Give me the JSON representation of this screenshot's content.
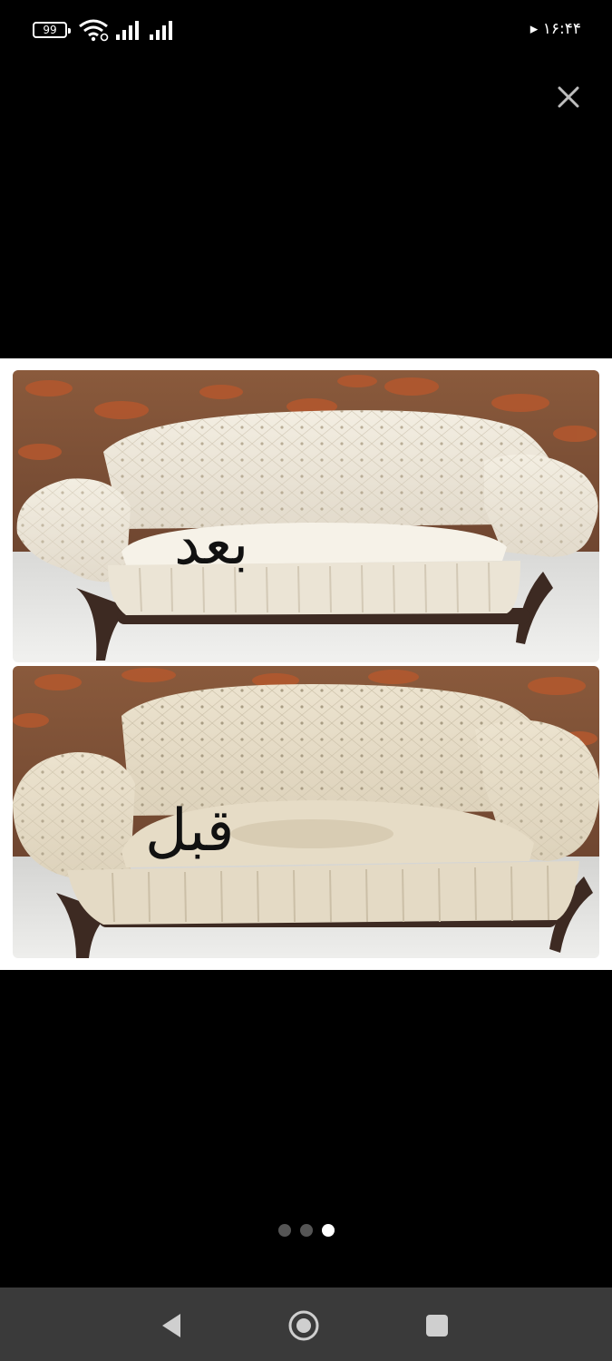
{
  "status_bar": {
    "battery": "99",
    "time": "۱۶:۴۴ ▸"
  },
  "viewer": {
    "photos": [
      {
        "caption": "بعد",
        "subject": "tufted cream sofa after cleaning"
      },
      {
        "caption": "قبل",
        "subject": "tufted cream sofa before cleaning"
      }
    ],
    "pager": {
      "count": 3,
      "active_index": 2
    }
  },
  "icons": {
    "close": "close-icon",
    "back": "back-triangle-icon",
    "home": "home-circle-icon",
    "recents": "recents-square-icon"
  },
  "colors": {
    "background": "#000000",
    "navbar": "#3a3a3a",
    "sofa": "#ece6d8",
    "legs": "#3d2a22"
  }
}
